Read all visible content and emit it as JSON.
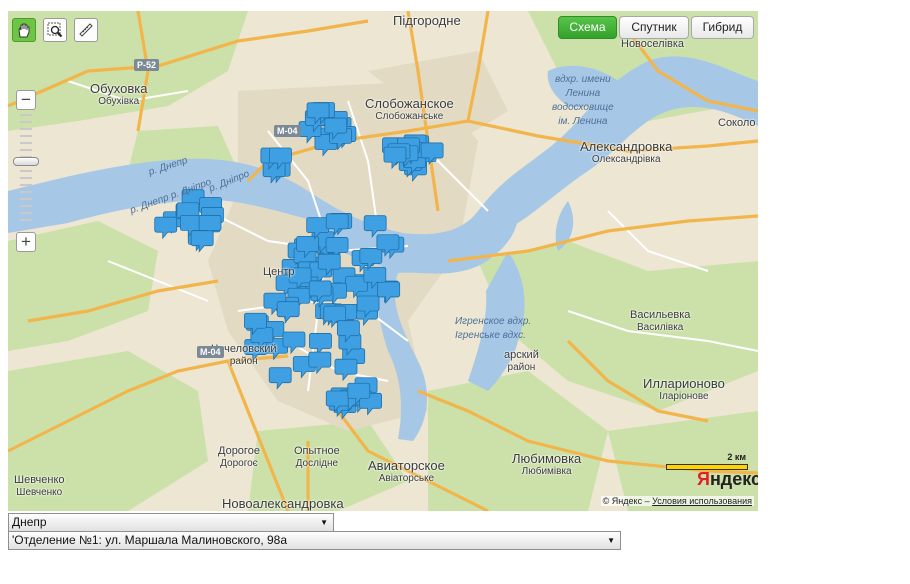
{
  "toolbar": {
    "tools": [
      "hand-icon",
      "zoom-area-icon",
      "ruler-icon"
    ],
    "map_types": [
      "Схема",
      "Спутник",
      "Гибрид"
    ],
    "selected_map_type": "Схема"
  },
  "map": {
    "places": {
      "pidhorodne": {
        "main": "Підгородне"
      },
      "obukhovka": {
        "main": "Обуховка",
        "sub": "Обухівка"
      },
      "slobozhanskoe": {
        "main": "Слобожанское",
        "sub": "Слобожанське"
      },
      "novoselovka": {
        "main": "Новоселівка"
      },
      "aleksandrovka": {
        "main": "Александровка",
        "sub": "Олександрівка"
      },
      "sokol": {
        "main": "Соколо"
      },
      "vasilevka": {
        "main": "Васильевка",
        "sub": "Василівка"
      },
      "illarionovo": {
        "main": "Илларионово",
        "sub": "Іларіонове"
      },
      "lyubimovka": {
        "main": "Любимовка",
        "sub": "Любимівка"
      },
      "aviatorskoe": {
        "main": "Авиаторское",
        "sub": "Авіаторське"
      },
      "opytnoe": {
        "main": "Опытное",
        "sub": "Дослідне"
      },
      "dorogoe": {
        "main": "Дорогое",
        "sub": "Дорогоє"
      },
      "shevchenko": {
        "main": "Шевченко",
        "sub": "Шевченко"
      },
      "novoaleksandrovka": {
        "main": "Новоалександровка"
      },
      "chechelovskiy": {
        "main": "Чечеловский",
        "sub": "район"
      },
      "tsentr": {
        "main": "Центр"
      },
      "zavodskoy": {
        "main": "арский",
        "sub": "район"
      }
    },
    "water": {
      "reservoir": [
        "вдхр. имени",
        "Ленина",
        "водосховище",
        "ім. Ленина"
      ],
      "igren": [
        "Игренское вдхр.",
        "Ігренське вдхс."
      ],
      "river_labels": [
        "р. Днепр",
        "р. Дніпро",
        "р. Днепр р. Дніпро"
      ]
    },
    "roads": [
      "Р-52",
      "М-04",
      "М-04"
    ],
    "scale_label": "2 км",
    "logo": {
      "y": "Я",
      "rest": "ндекс"
    },
    "copyright": "© Яндекс –",
    "terms_link": "Условия использования",
    "zoom": {
      "plus": "+",
      "minus": "−",
      "level_fraction": 0.58
    },
    "marker_color": "#3ea0e3",
    "marker_count": 118
  },
  "controls": {
    "city_select": "Днепр",
    "branch_select": "'Отделение №1: ул. Маршала Малиновского, 98а"
  },
  "colors": {
    "land": "#e9e3d0",
    "green": "#c7dfa4",
    "water": "#a6c8e6",
    "major_road": "#f3b54a",
    "minor_road": "#ffffff",
    "accent": "#43b23a"
  }
}
